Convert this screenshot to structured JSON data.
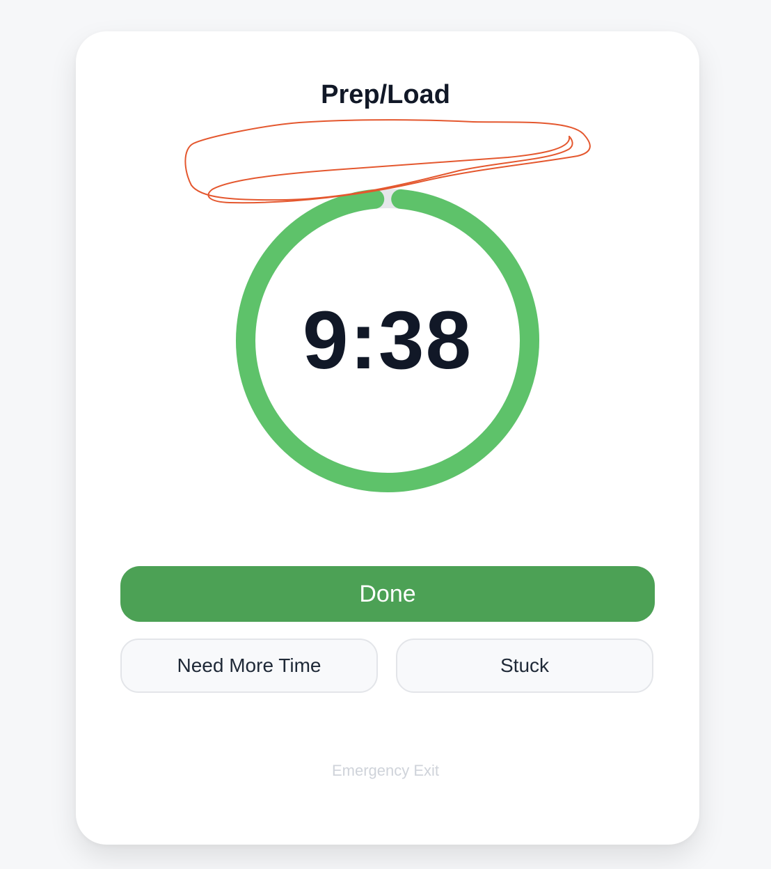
{
  "task": {
    "title": "Prep/Load",
    "time_remaining": "9:38",
    "progress_fraction": 0.97
  },
  "actions": {
    "done_label": "Done",
    "need_more_time_label": "Need More Time",
    "stuck_label": "Stuck",
    "emergency_exit_label": "Emergency Exit"
  },
  "colors": {
    "ring_progress": "#5ec26a",
    "ring_track": "#e5e7eb",
    "done_button": "#4ca155",
    "annotation_stroke": "#e4572e"
  }
}
